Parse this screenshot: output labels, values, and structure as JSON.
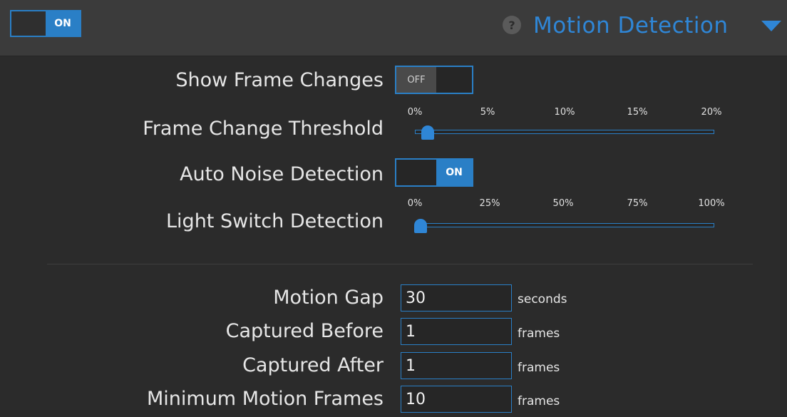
{
  "header": {
    "enabled_label": "ON",
    "help_icon": "?",
    "title": "Motion Detection",
    "collapse_icon": "triangle-down"
  },
  "settings": {
    "show_frame_changes": {
      "label": "Show Frame Changes",
      "state": "OFF"
    },
    "frame_change_threshold": {
      "label": "Frame Change Threshold",
      "ticks": [
        "0%",
        "5%",
        "10%",
        "15%",
        "20%"
      ],
      "value_percent": 0.5
    },
    "auto_noise_detection": {
      "label": "Auto Noise Detection",
      "state": "ON"
    },
    "light_switch_detection": {
      "label": "Light Switch Detection",
      "ticks": [
        "0%",
        "25%",
        "50%",
        "75%",
        "100%"
      ],
      "value_percent": 0
    }
  },
  "timing": {
    "motion_gap": {
      "label": "Motion Gap",
      "value": "30",
      "unit": "seconds"
    },
    "captured_before": {
      "label": "Captured Before",
      "value": "1",
      "unit": "frames"
    },
    "captured_after": {
      "label": "Captured After",
      "value": "1",
      "unit": "frames"
    },
    "minimum_motion_frames": {
      "label": "Minimum Motion Frames",
      "value": "10",
      "unit": "frames"
    }
  },
  "colors": {
    "accent": "#2f86d6",
    "background": "#2b2b2b",
    "header_background": "#3b3b3b"
  }
}
